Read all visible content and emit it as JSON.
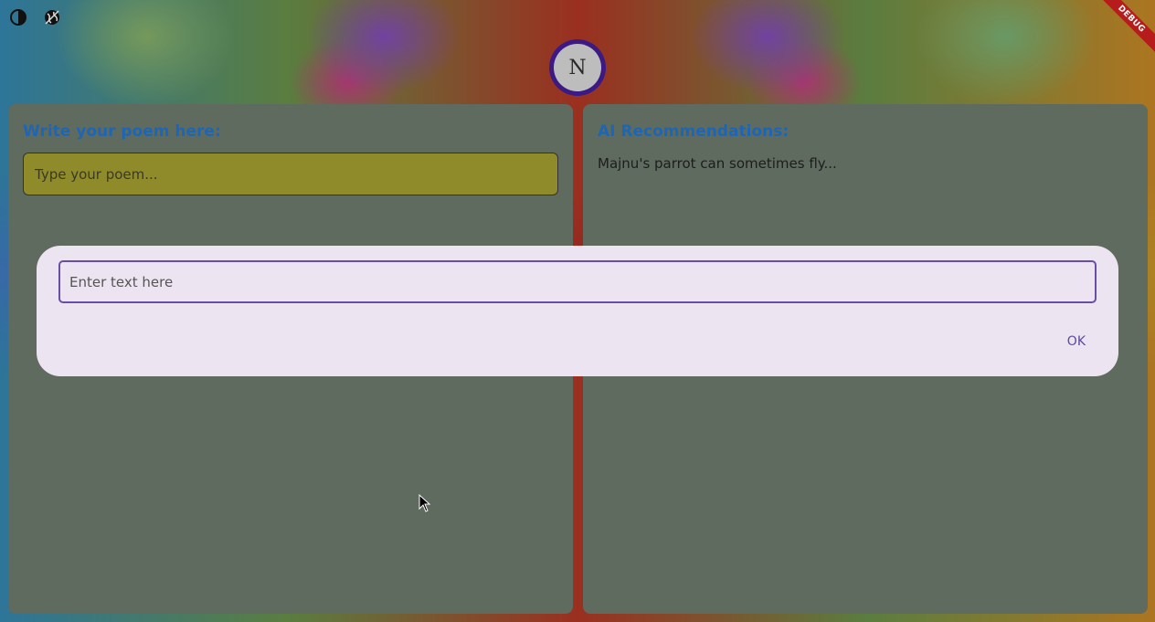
{
  "debug_banner": "DEBUG",
  "toolbar": {
    "contrast_icon": "contrast-icon",
    "globe_icon": "globe-icon"
  },
  "avatar": {
    "initial": "N"
  },
  "left_panel": {
    "title": "Write your poem here:",
    "input_placeholder": "Type your poem..."
  },
  "right_panel": {
    "title": "AI Recommendations:",
    "text": "Majnu's parrot can sometimes fly..."
  },
  "dialog": {
    "input_placeholder": "Enter text here",
    "ok_label": "OK"
  },
  "colors": {
    "title_blue": "#1e66b5",
    "panel_bg": "#5e6b5e",
    "poem_input_bg": "#8f8a2a",
    "dialog_bg": "#ece4f1",
    "dialog_accent": "#6750a4",
    "avatar_ring": "#3c1a86",
    "debug_red": "#b71c1c"
  }
}
